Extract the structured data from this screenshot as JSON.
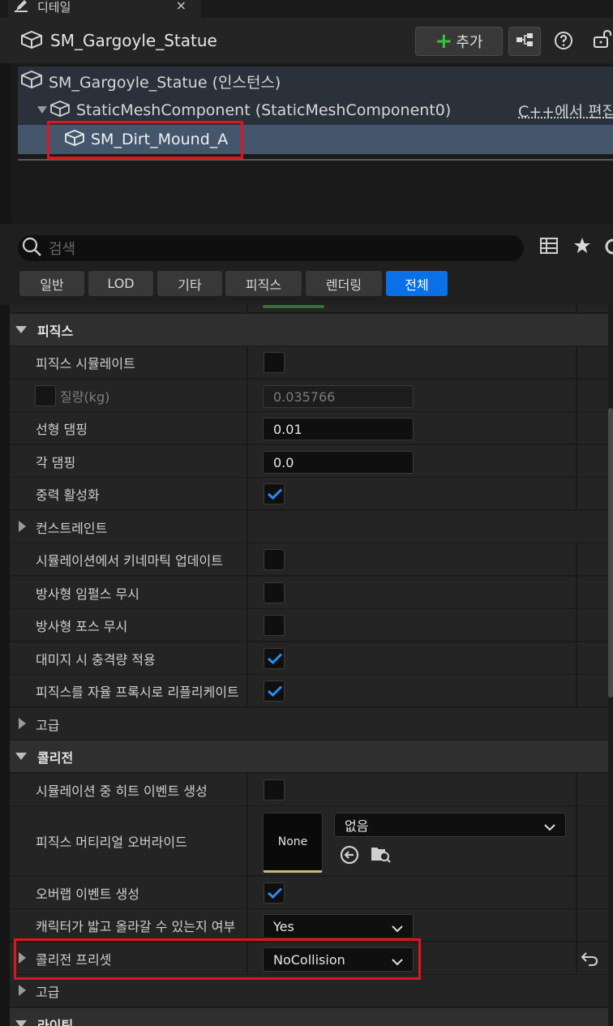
{
  "tab": {
    "title": "디테일",
    "close": "×"
  },
  "header": {
    "object_name": "SM_Gargoyle_Statue",
    "add_label": "추가"
  },
  "tree": {
    "rows": [
      {
        "label": "SM_Gargoyle_Statue (인스턴스)"
      },
      {
        "label": "StaticMeshComponent (StaticMeshComponent0)",
        "action": "C++에서 편집"
      },
      {
        "label": "SM_Dirt_Mound_A"
      }
    ]
  },
  "search": {
    "placeholder": "검색"
  },
  "filters": [
    "일반",
    "LOD",
    "기타",
    "피직스",
    "렌더링",
    "전체"
  ],
  "active_filter": "전체",
  "physics": {
    "title": "피직스",
    "simulate": "피직스 시뮬레이트",
    "mass": "질량(kg)",
    "mass_value": "0.035766",
    "linear_damping": "선형 댐핑",
    "linear_damping_value": "0.01",
    "angular_damping": "각 댐핑",
    "angular_damping_value": "0.0",
    "enable_gravity": "중력 활성화",
    "constraints": "컨스트레인트",
    "kinematic_update": "시뮬레이션에서 키네마틱 업데이트",
    "ignore_radial_impulse": "방사형 임펄스 무시",
    "ignore_radial_force": "방사형 포스 무시",
    "apply_impulse_on_damage": "대미지 시 충격량 적용",
    "replicate_physics": "피직스를 자율 프록시로 리플리케이트",
    "advanced": "고급"
  },
  "collision": {
    "title": "콜리전",
    "hit_events": "시뮬레이션 중 히트 이벤트 생성",
    "phys_material_override": "피직스 머티리얼 오버라이드",
    "material_thumb": "None",
    "material_value": "없음",
    "overlap_events": "오버랩 이벤트 생성",
    "can_step_up": "캐릭터가 밟고 올라갈 수 있는지 여부",
    "can_step_up_value": "Yes",
    "presets": "콜리전 프리셋",
    "presets_value": "NoCollision",
    "advanced": "고급"
  },
  "lighting": {
    "title": "라이팅"
  },
  "colors": {
    "accent": "#0a70e6",
    "check": "#2a8cf0",
    "highlight": "#e0141e",
    "add": "#36c436"
  }
}
